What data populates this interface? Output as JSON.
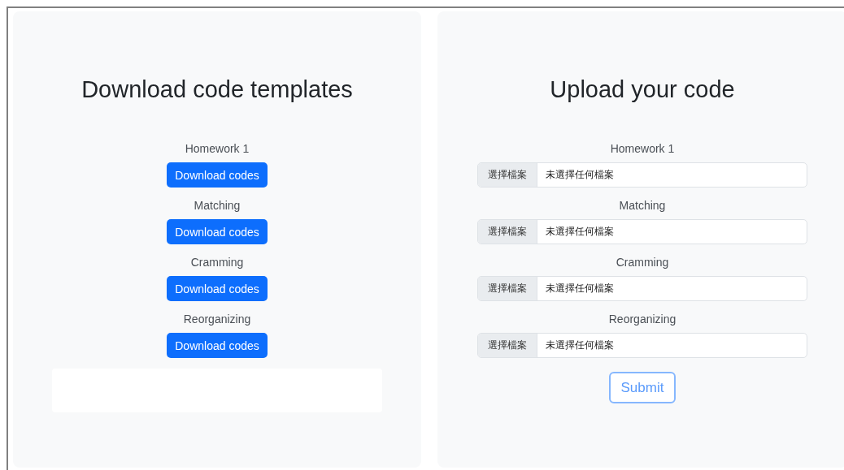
{
  "download": {
    "title": "Download code templates",
    "items": [
      {
        "label": "Homework 1",
        "button": "Download codes"
      },
      {
        "label": "Matching",
        "button": "Download codes"
      },
      {
        "label": "Cramming",
        "button": "Download codes"
      },
      {
        "label": "Reorganizing",
        "button": "Download codes"
      }
    ]
  },
  "upload": {
    "title": "Upload your code",
    "items": [
      {
        "label": "Homework 1",
        "button": "選擇檔案",
        "status": "未選擇任何檔案"
      },
      {
        "label": "Matching",
        "button": "選擇檔案",
        "status": "未選擇任何檔案"
      },
      {
        "label": "Cramming",
        "button": "選擇檔案",
        "status": "未選擇任何檔案"
      },
      {
        "label": "Reorganizing",
        "button": "選擇檔案",
        "status": "未選擇任何檔案"
      }
    ],
    "submit": "Submit"
  }
}
